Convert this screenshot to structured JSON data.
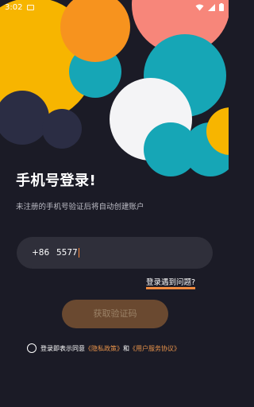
{
  "status_bar": {
    "time": "3:02",
    "icons": [
      "notification-icon",
      "wifi-icon",
      "signal-icon",
      "battery-icon"
    ]
  },
  "login": {
    "title": "手机号登录!",
    "subtitle": "未注册的手机号验证后将自动创建账户",
    "phone_prefix": "+86",
    "phone_value": "5577",
    "help_link": "登录遇到问题?",
    "code_button": "获取验证码",
    "agreement": {
      "prefix": "登录即表示同意",
      "privacy": "《隐私政策》",
      "and": "和",
      "terms": "《用户服务协议》"
    }
  },
  "colors": {
    "background": "#1b1b26",
    "yellow": "#f7b500",
    "orange": "#f7931e",
    "teal": "#16a6b6",
    "pink": "#f7867a",
    "white": "#f4f4f6",
    "navy": "#2b2d44",
    "button": "#6a4930",
    "accent": "#f08a3e"
  }
}
